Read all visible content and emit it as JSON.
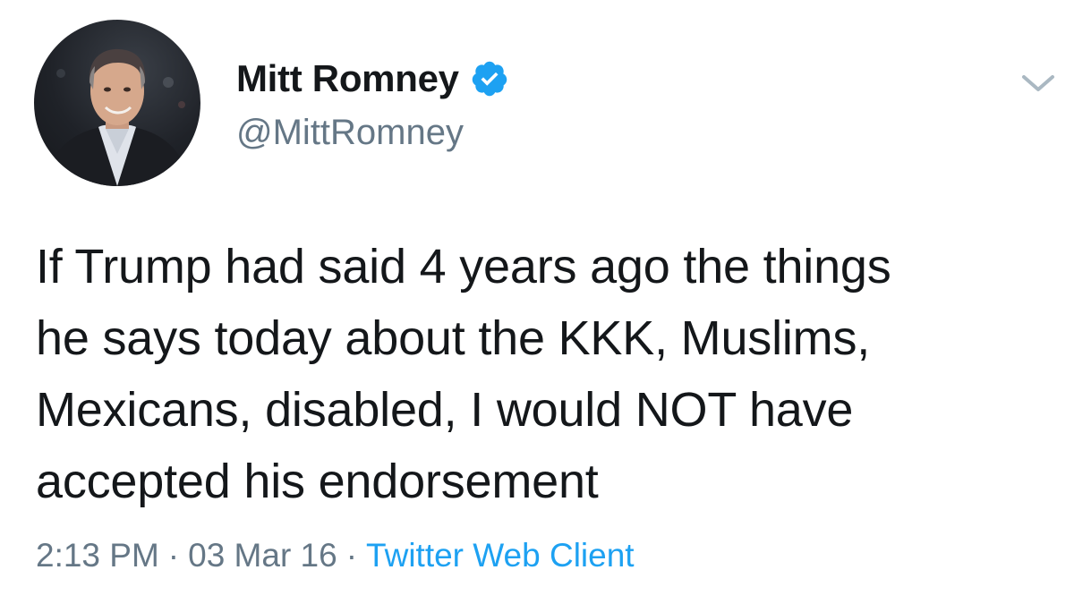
{
  "author": {
    "display_name": "Mitt Romney",
    "handle": "@MittRomney",
    "verified": true,
    "avatar": "profile-photo"
  },
  "tweet": {
    "text_lines": [
      "If Trump had said 4 years ago the things",
      "he says today about the KKK, Muslims,",
      "Mexicans, disabled, I would NOT have",
      "accepted his endorsement"
    ],
    "time": "2:13 PM",
    "separator": "·",
    "date": "03 Mar 16",
    "client": "Twitter Web Client"
  },
  "icons": {
    "verified": "verified-badge-icon",
    "menu": "chevron-down-icon"
  },
  "colors": {
    "text": "#14171a",
    "secondary": "#657786",
    "link": "#1da1f2",
    "verified": "#1da1f2"
  }
}
